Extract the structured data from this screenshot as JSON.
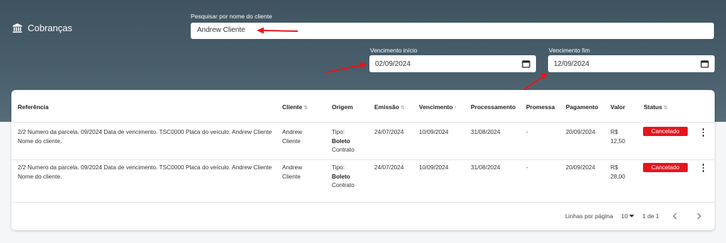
{
  "brand": {
    "title": "Cobranças",
    "icon": "bank-icon"
  },
  "search": {
    "label": "Pesquisar por nome do cliente",
    "value": "Andrew Cliente"
  },
  "date_start": {
    "label": "Vencimento início",
    "value": "02/09/2024"
  },
  "date_end": {
    "label": "Vencimento fim",
    "value": "12/09/2024"
  },
  "annotation_color": "#e8141c",
  "table": {
    "headers": {
      "referencia": "Referência",
      "cliente": "Cliente",
      "origem": "Origem",
      "emissao": "Emissão",
      "vencimento": "Vencimento",
      "processamento": "Processamento",
      "promessa": "Promessa",
      "pagamento": "Pagamento",
      "valor": "Valor",
      "status": "Status"
    },
    "sort_icons": {
      "sortable": "⇅",
      "active": "↑"
    },
    "rows": [
      {
        "referencia": "2/2 Numero da parcela. 09/2024 Data de vencimento. TSC0000 Placa do veículo. Andrew Cliente Nome do cliente.",
        "cliente": "Andrew Cliente",
        "origem_tipo": "Tipo:",
        "origem_metodo": "Boleto",
        "origem_extra": "Contrato",
        "emissao": "24/07/2024",
        "vencimento": "10/09/2024",
        "processamento": "31/08/2024",
        "promessa": "-",
        "pagamento": "20/09/2024",
        "valor_moeda": "R$",
        "valor": "12,50",
        "status": "Cancelado"
      },
      {
        "referencia": "2/2 Numero da parcela. 09/2024 Data de vencimento. TSC0000 Placa do veículo. Andrew Cliente Nome do cliente.",
        "cliente": "Andrew Cliente",
        "origem_tipo": "Tipo:",
        "origem_metodo": "Boleto",
        "origem_extra": "Contrato",
        "emissao": "24/07/2024",
        "vencimento": "10/09/2024",
        "processamento": "31/08/2024",
        "promessa": "-",
        "pagamento": "20/09/2024",
        "valor_moeda": "R$",
        "valor": "28,00",
        "status": "Cancelado"
      }
    ],
    "status_color": "#e8141c"
  },
  "pagination": {
    "rows_per_page_label": "Linhas por página",
    "rows_per_page": "10",
    "range": "1 de 1",
    "prev_icon": "chevron-left-icon",
    "next_icon": "chevron-right-icon"
  }
}
